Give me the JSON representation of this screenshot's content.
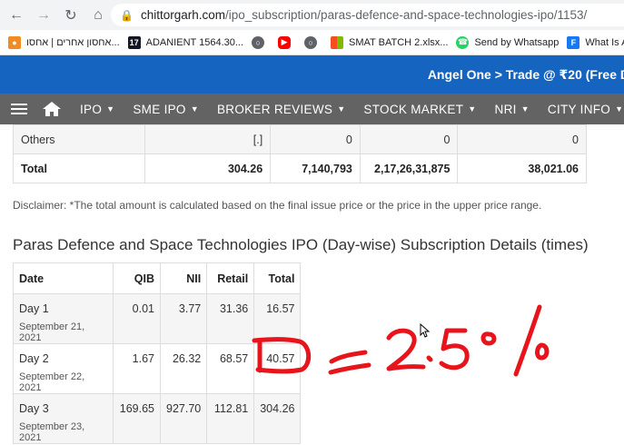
{
  "browser": {
    "url_host": "chittorgarh.com",
    "url_path": "/ipo_subscription/paras-defence-and-space-technologies-ipo/1153/",
    "bookmarks": [
      {
        "label": "אחסון אחרים | אחסו...",
        "icon": "orange-icon",
        "color": "#f28b20"
      },
      {
        "label": "ADANIENT 1564.30...",
        "icon": "tradingview-icon",
        "color": "#131722"
      },
      {
        "label": "",
        "icon": "globe-icon",
        "color": "#5f6368"
      },
      {
        "label": "",
        "icon": "youtube-icon",
        "color": "#ff0000"
      },
      {
        "label": "",
        "icon": "globe-icon",
        "color": "#5f6368"
      },
      {
        "label": "SMAT BATCH 2.xlsx...",
        "icon": "microsoft-icon",
        "color": "#f25022"
      },
      {
        "label": "Send by Whatsapp",
        "icon": "whatsapp-icon",
        "color": "#25d366"
      },
      {
        "label": "What Is A",
        "icon": "f-icon",
        "color": "#1877f2"
      }
    ]
  },
  "promo": {
    "text": "Angel One > Trade @ ₹20 (Free D"
  },
  "nav": {
    "items": [
      "IPO",
      "SME IPO",
      "BROKER REVIEWS",
      "STOCK MARKET",
      "NRI",
      "CITY INFO"
    ]
  },
  "category_table": {
    "rows": [
      {
        "label": "Others",
        "cells": [
          "[.]",
          "0",
          "0",
          "0"
        ]
      },
      {
        "label": "Total",
        "cells": [
          "304.26",
          "7,140,793",
          "2,17,26,31,875",
          "38,021.06"
        ]
      }
    ]
  },
  "disclaimer": "Disclaimer: *The total amount is calculated based on the final issue price or the price in the upper price range.",
  "daywise": {
    "heading": "Paras Defence and Space Technologies IPO (Day-wise) Subscription Details (times)",
    "headers": [
      "Date",
      "QIB",
      "NII",
      "Retail",
      "Total"
    ],
    "rows": [
      {
        "day": "Day 1",
        "date": "September 21, 2021",
        "qib": "0.01",
        "nii": "3.77",
        "retail": "31.36",
        "total": "16.57"
      },
      {
        "day": "Day 2",
        "date": "September 22, 2021",
        "qib": "1.67",
        "nii": "26.32",
        "retail": "68.57",
        "total": "40.57"
      },
      {
        "day": "Day 3",
        "date": "September 23, 2021",
        "qib": "169.65",
        "nii": "927.70",
        "retail": "112.81",
        "total": "304.26"
      }
    ]
  },
  "annotation": {
    "text": "≥2.5%",
    "color": "#e8141c"
  }
}
